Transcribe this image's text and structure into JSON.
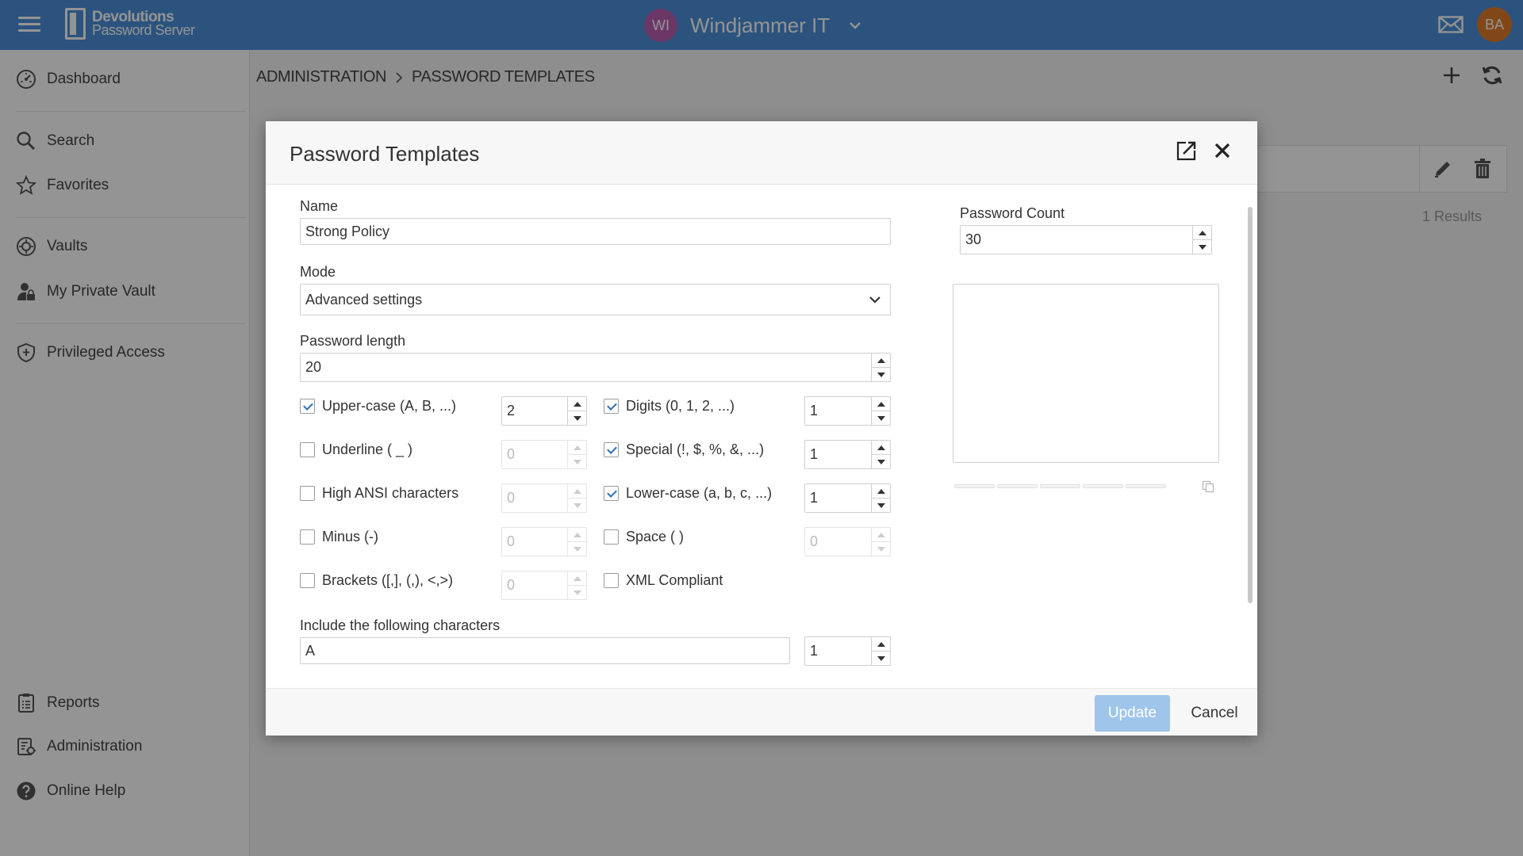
{
  "app": {
    "logo_line1": "Devolutions",
    "logo_line2": "Password Server",
    "workspace_initials": "WI",
    "workspace_name": "Windjammer IT",
    "user_initials": "BA"
  },
  "colors": {
    "topbar": "#4a90d9",
    "workspace_avatar": "#b85fb1",
    "user_avatar": "#e07b2a",
    "update_button": "#9fc5ea"
  },
  "sidebar": {
    "items": [
      {
        "label": "Dashboard",
        "icon": "dashboard-icon"
      },
      {
        "label": "Search",
        "icon": "search-icon"
      },
      {
        "label": "Favorites",
        "icon": "star-icon"
      },
      {
        "label": "Vaults",
        "icon": "vault-icon"
      },
      {
        "label": "My Private Vault",
        "icon": "private-vault-icon"
      },
      {
        "label": "Privileged Access",
        "icon": "shield-icon"
      },
      {
        "label": "Reports",
        "icon": "report-icon"
      },
      {
        "label": "Administration",
        "icon": "administration-icon"
      },
      {
        "label": "Online Help",
        "icon": "help-icon"
      }
    ]
  },
  "breadcrumb": {
    "parent": "ADMINISTRATION",
    "current": "PASSWORD TEMPLATES"
  },
  "results_text": "1 Results",
  "modal": {
    "title": "Password Templates",
    "name_label": "Name",
    "name_value": "Strong Policy",
    "mode_label": "Mode",
    "mode_value": "Advanced settings",
    "length_label": "Password length",
    "length_value": "20",
    "options": [
      {
        "label": "Upper-case (A, B, ...)",
        "checked": true,
        "count": "2"
      },
      {
        "label": "Digits (0, 1, 2, ...)",
        "checked": true,
        "count": "1"
      },
      {
        "label": "Underline ( _ )",
        "checked": false,
        "count": "0"
      },
      {
        "label": "Special (!, $, %, &, ...)",
        "checked": true,
        "count": "1"
      },
      {
        "label": "High ANSI characters",
        "checked": false,
        "count": "0"
      },
      {
        "label": "Lower-case (a, b, c, ...)",
        "checked": true,
        "count": "1"
      },
      {
        "label": "Minus (-)",
        "checked": false,
        "count": "0"
      },
      {
        "label": "Space ( )",
        "checked": false,
        "count": "0"
      },
      {
        "label": "Brackets ([,], (,), <,>)",
        "checked": false,
        "count": "0"
      },
      {
        "label": "XML Compliant",
        "checked": false
      }
    ],
    "include_label": "Include the following characters",
    "include_value": "A",
    "include_count": "1",
    "password_count_label": "Password Count",
    "password_count_value": "30",
    "update_label": "Update",
    "cancel_label": "Cancel"
  }
}
